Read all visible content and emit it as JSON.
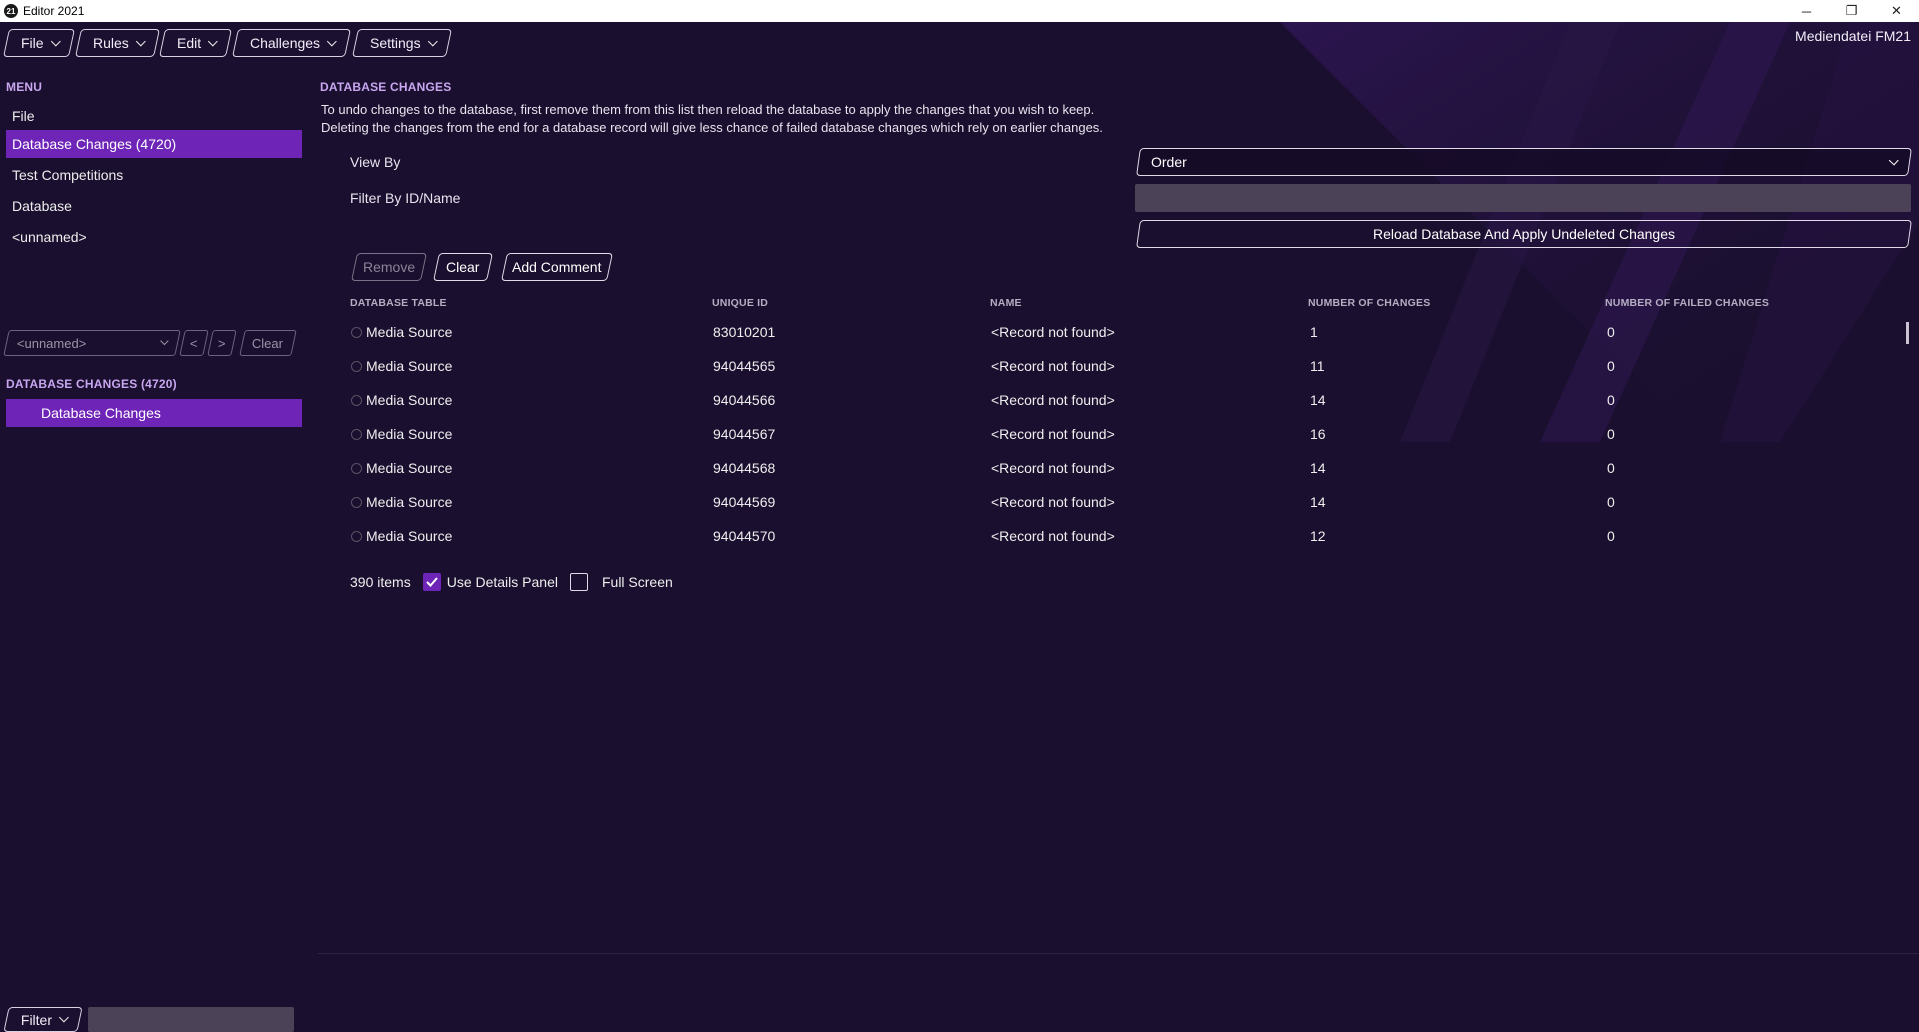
{
  "window": {
    "title": "Editor 2021",
    "app_icon_text": "21",
    "minimize": "─",
    "restore": "❐",
    "close": "✕"
  },
  "topbar": {
    "menus": [
      "File",
      "Rules",
      "Edit",
      "Challenges",
      "Settings"
    ],
    "brand": "Mediendatei FM21"
  },
  "sidebar": {
    "menu_title": "MENU",
    "items": [
      "File",
      "Database Changes (4720)",
      "Test Competitions",
      "Database",
      "<unnamed>"
    ],
    "active_index": 1,
    "nav_select": "<unnamed>",
    "nav_prev": "<",
    "nav_next": ">",
    "nav_clear": "Clear",
    "section_title": "DATABASE CHANGES (4720)",
    "section_item": "Database Changes",
    "bottom_filter": "Filter"
  },
  "main": {
    "title": "DATABASE CHANGES",
    "desc_line1": "To undo changes to the database, first remove them from this list then reload the database to apply the changes that you wish to keep.",
    "desc_line2": "Deleting the changes from the end for a database record will give less chance of failed database changes which rely on earlier changes.",
    "view_by_label": "View By",
    "view_by_value": "Order",
    "filter_label": "Filter By ID/Name",
    "filter_value": "",
    "reload_button": "Reload Database And Apply Undeleted Changes",
    "remove_button": "Remove",
    "clear_button": "Clear",
    "add_comment_button": "Add Comment",
    "columns": [
      "DATABASE TABLE",
      "UNIQUE ID",
      "NAME",
      "NUMBER OF CHANGES",
      "NUMBER OF FAILED CHANGES"
    ],
    "rows": [
      [
        "Media Source",
        "83010201",
        "<Record not found>",
        "1",
        "0"
      ],
      [
        "Media Source",
        "94044565",
        "<Record not found>",
        "11",
        "0"
      ],
      [
        "Media Source",
        "94044566",
        "<Record not found>",
        "14",
        "0"
      ],
      [
        "Media Source",
        "94044567",
        "<Record not found>",
        "16",
        "0"
      ],
      [
        "Media Source",
        "94044568",
        "<Record not found>",
        "14",
        "0"
      ],
      [
        "Media Source",
        "94044569",
        "<Record not found>",
        "14",
        "0"
      ],
      [
        "Media Source",
        "94044570",
        "<Record not found>",
        "12",
        "0"
      ]
    ],
    "item_count": "390 items",
    "use_details_label": "Use Details Panel",
    "use_details_checked": true,
    "full_screen_label": "Full Screen",
    "full_screen_checked": false
  },
  "colors": {
    "background": "#1a0f2e",
    "accent": "#6f24b8",
    "section_title": "#c8a6f0"
  }
}
